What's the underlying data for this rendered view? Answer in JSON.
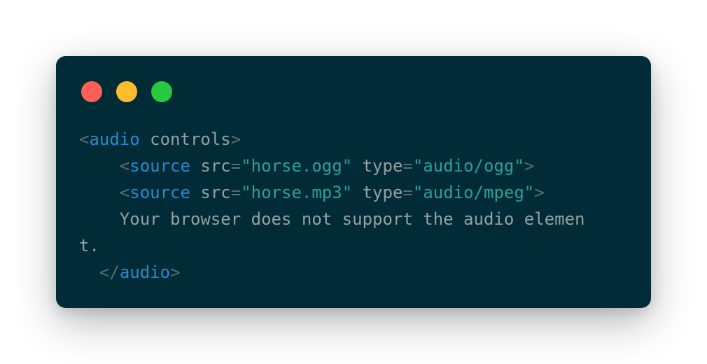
{
  "colors": {
    "background": "#ffffff",
    "card": "#012b36",
    "dot_red": "#ff5f56",
    "dot_yellow": "#ffbd2e",
    "dot_green": "#27c93f",
    "punct": "#586e75",
    "tag": "#268bd2",
    "attr": "#93a1a1",
    "string": "#2aa198",
    "text": "#93a1a1"
  },
  "window_dots": [
    "close-dot",
    "minimize-dot",
    "maximize-dot"
  ],
  "code": {
    "l1": {
      "open": "<",
      "tag": "audio",
      "rest": " controls",
      "close": ">"
    },
    "l2": {
      "indent": "    ",
      "open": "<",
      "tag": "source",
      "a1": " src",
      "eq1": "=",
      "v1": "\"horse.ogg\"",
      "a2": " type",
      "eq2": "=",
      "v2": "\"audio/ogg\"",
      "close": ">"
    },
    "l3": {
      "indent": "    ",
      "open": "<",
      "tag": "source",
      "a1": " src",
      "eq1": "=",
      "v1": "\"horse.mp3\"",
      "a2": " type",
      "eq2": "=",
      "v2": "\"audio/mpeg\"",
      "close": ">"
    },
    "l4": {
      "text": "    Your browser does not support the audio elemen"
    },
    "l5": {
      "text": "t."
    },
    "l6": {
      "indent": "  ",
      "open": "</",
      "tag": "audio",
      "close": ">"
    }
  }
}
